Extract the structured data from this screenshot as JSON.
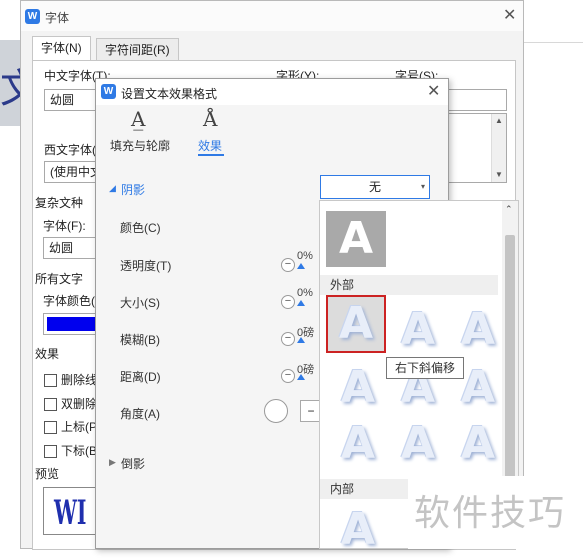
{
  "font_dialog": {
    "title": "字体",
    "tabs": [
      "字体(N)",
      "字符间距(R)"
    ],
    "chinese_font_label": "中文字体(T):",
    "chinese_font_value": "幼圆",
    "style_label": "字形(Y):",
    "size_label": "字号(S):",
    "western_font_label": "西文字体(",
    "western_font_value": "(使用中文",
    "complex_section": "复杂文种",
    "complex_font_label": "字体(F):",
    "complex_font_value": "幼圆",
    "all_text_section": "所有文字",
    "font_color_label": "字体颜色(",
    "font_color": "#0000ee",
    "effects_section": "效果",
    "effects": [
      "删除线",
      "双删除",
      "上标(P",
      "下标(B"
    ],
    "preview_label": "预览",
    "preview_text": "WI"
  },
  "effect_dialog": {
    "title": "设置文本效果格式",
    "tabs": [
      "填充与轮廓",
      "效果"
    ],
    "shadow_section": "阴影",
    "shadow_value": "无",
    "rows": [
      {
        "label": "颜色(C)"
      },
      {
        "label": "透明度(T)",
        "value": "0%"
      },
      {
        "label": "大小(S)",
        "value": "0%"
      },
      {
        "label": "模糊(B)",
        "value": "0磅"
      },
      {
        "label": "距离(D)",
        "value": "0磅"
      },
      {
        "label": "角度(A)"
      }
    ],
    "reflection_section": "倒影"
  },
  "shadow_gallery": {
    "sections": [
      "外部",
      "内部"
    ],
    "glyph": "A",
    "tooltip": "右下斜偏移"
  },
  "watermark": "软件技巧",
  "accent_color": "#2f7ae5",
  "selection_color": "#cc2222"
}
